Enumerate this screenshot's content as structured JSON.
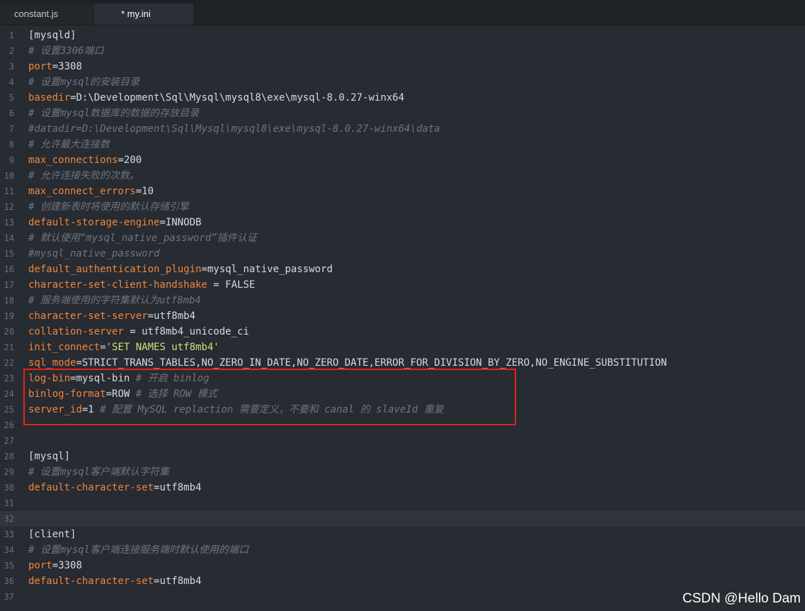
{
  "tabs": [
    {
      "label": "constant.js",
      "active": false
    },
    {
      "label": "* my.ini",
      "active": true
    }
  ],
  "lines": [
    {
      "n": "1",
      "parts": [
        {
          "t": "sec",
          "v": "[mysqld]"
        }
      ]
    },
    {
      "n": "2",
      "parts": [
        {
          "t": "cmt",
          "v": "# 设置3306端口"
        }
      ]
    },
    {
      "n": "3",
      "parts": [
        {
          "t": "key",
          "v": "port"
        },
        {
          "t": "op",
          "v": "="
        },
        {
          "t": "val",
          "v": "3308"
        }
      ]
    },
    {
      "n": "4",
      "parts": [
        {
          "t": "cmt",
          "v": "# 设置mysql的安装目录"
        }
      ]
    },
    {
      "n": "5",
      "parts": [
        {
          "t": "key",
          "v": "basedir"
        },
        {
          "t": "op",
          "v": "="
        },
        {
          "t": "val",
          "v": "D:\\Development\\Sql\\Mysql\\mysql8\\exe\\mysql-8.0.27-winx64"
        }
      ]
    },
    {
      "n": "6",
      "parts": [
        {
          "t": "cmt",
          "v": "# 设置mysql数据库的数据的存放目录"
        }
      ]
    },
    {
      "n": "7",
      "parts": [
        {
          "t": "cmt",
          "v": "#datadir=D:\\Development\\Sql\\Mysql\\mysql8\\exe\\mysql-8.0.27-winx64\\data"
        }
      ]
    },
    {
      "n": "8",
      "parts": [
        {
          "t": "cmt",
          "v": "# 允许最大连接数"
        }
      ]
    },
    {
      "n": "9",
      "parts": [
        {
          "t": "key",
          "v": "max_connections"
        },
        {
          "t": "op",
          "v": "="
        },
        {
          "t": "val",
          "v": "200"
        }
      ]
    },
    {
      "n": "10",
      "parts": [
        {
          "t": "cmt",
          "v": "# 允许连接失败的次数。"
        }
      ]
    },
    {
      "n": "11",
      "parts": [
        {
          "t": "key",
          "v": "max_connect_errors"
        },
        {
          "t": "op",
          "v": "="
        },
        {
          "t": "val",
          "v": "10"
        }
      ]
    },
    {
      "n": "12",
      "parts": [
        {
          "t": "cmt",
          "v": "# 创建新表时将使用的默认存储引擎"
        }
      ]
    },
    {
      "n": "13",
      "parts": [
        {
          "t": "key",
          "v": "default-storage-engine"
        },
        {
          "t": "op",
          "v": "="
        },
        {
          "t": "val",
          "v": "INNODB"
        }
      ]
    },
    {
      "n": "14",
      "parts": [
        {
          "t": "cmt",
          "v": "# 默认使用“mysql_native_password”插件认证"
        }
      ]
    },
    {
      "n": "15",
      "parts": [
        {
          "t": "cmt",
          "v": "#mysql_native_password"
        }
      ]
    },
    {
      "n": "16",
      "parts": [
        {
          "t": "key",
          "v": "default_authentication_plugin"
        },
        {
          "t": "op",
          "v": "="
        },
        {
          "t": "val",
          "v": "mysql_native_password"
        }
      ]
    },
    {
      "n": "17",
      "parts": [
        {
          "t": "key",
          "v": "character-set-client-handshake"
        },
        {
          "t": "op",
          "v": " = "
        },
        {
          "t": "val",
          "v": "FALSE"
        }
      ]
    },
    {
      "n": "18",
      "parts": [
        {
          "t": "cmt",
          "v": "# 服务端使用的字符集默认为utf8mb4"
        }
      ]
    },
    {
      "n": "19",
      "parts": [
        {
          "t": "key",
          "v": "character-set-server"
        },
        {
          "t": "op",
          "v": "="
        },
        {
          "t": "val",
          "v": "utf8mb4"
        }
      ]
    },
    {
      "n": "20",
      "parts": [
        {
          "t": "key",
          "v": "collation-server"
        },
        {
          "t": "op",
          "v": " = "
        },
        {
          "t": "val",
          "v": "utf8mb4_unicode_ci"
        }
      ]
    },
    {
      "n": "21",
      "parts": [
        {
          "t": "key",
          "v": "init_connect"
        },
        {
          "t": "op",
          "v": "="
        },
        {
          "t": "str",
          "v": "'SET NAMES utf8mb4'"
        }
      ]
    },
    {
      "n": "22",
      "parts": [
        {
          "t": "key",
          "v": "sql_mode"
        },
        {
          "t": "op",
          "v": "="
        },
        {
          "t": "val",
          "v": "STRICT_TRANS_TABLES,NO_ZERO_IN_DATE,NO_ZERO_DATE,ERROR_FOR_DIVISION_BY_ZERO,NO_ENGINE_SUBSTITUTION"
        }
      ]
    },
    {
      "n": "23",
      "parts": [
        {
          "t": "key",
          "v": "log-bin"
        },
        {
          "t": "op",
          "v": "="
        },
        {
          "t": "val",
          "v": "mysql-bin "
        },
        {
          "t": "cmt",
          "v": "# 开启 binlog"
        }
      ]
    },
    {
      "n": "24",
      "parts": [
        {
          "t": "key",
          "v": "binlog-format"
        },
        {
          "t": "op",
          "v": "="
        },
        {
          "t": "val",
          "v": "ROW "
        },
        {
          "t": "cmt",
          "v": "# 选择 ROW 模式"
        }
      ]
    },
    {
      "n": "25",
      "parts": [
        {
          "t": "key",
          "v": "server_id"
        },
        {
          "t": "op",
          "v": "="
        },
        {
          "t": "val",
          "v": "1 "
        },
        {
          "t": "cmt",
          "v": "# 配置 MySQL replaction 需要定义，不要和 canal 的 slaveId 重复"
        }
      ]
    },
    {
      "n": "26",
      "parts": []
    },
    {
      "n": "27",
      "parts": []
    },
    {
      "n": "28",
      "parts": [
        {
          "t": "sec",
          "v": "[mysql]"
        }
      ]
    },
    {
      "n": "29",
      "parts": [
        {
          "t": "cmt",
          "v": "# 设置mysql客户端默认字符集"
        }
      ]
    },
    {
      "n": "30",
      "parts": [
        {
          "t": "key",
          "v": "default-character-set"
        },
        {
          "t": "op",
          "v": "="
        },
        {
          "t": "val",
          "v": "utf8mb4"
        }
      ]
    },
    {
      "n": "31",
      "parts": []
    },
    {
      "n": "32",
      "parts": [],
      "current": true
    },
    {
      "n": "33",
      "parts": [
        {
          "t": "sec",
          "v": "[client]"
        }
      ]
    },
    {
      "n": "34",
      "parts": [
        {
          "t": "cmt",
          "v": "# 设置mysql客户端连接服务端时默认使用的端口"
        }
      ]
    },
    {
      "n": "35",
      "parts": [
        {
          "t": "key",
          "v": "port"
        },
        {
          "t": "op",
          "v": "="
        },
        {
          "t": "val",
          "v": "3308"
        }
      ]
    },
    {
      "n": "36",
      "parts": [
        {
          "t": "key",
          "v": "default-character-set"
        },
        {
          "t": "op",
          "v": "="
        },
        {
          "t": "val",
          "v": "utf8mb4"
        }
      ]
    },
    {
      "n": "37",
      "parts": []
    }
  ],
  "watermark": "CSDN @Hello Dam",
  "colors": {
    "background": "#272b32",
    "key": "#f0863a",
    "string": "#c7e478",
    "comment": "#6f7480",
    "highlight_border": "#e1251b"
  }
}
